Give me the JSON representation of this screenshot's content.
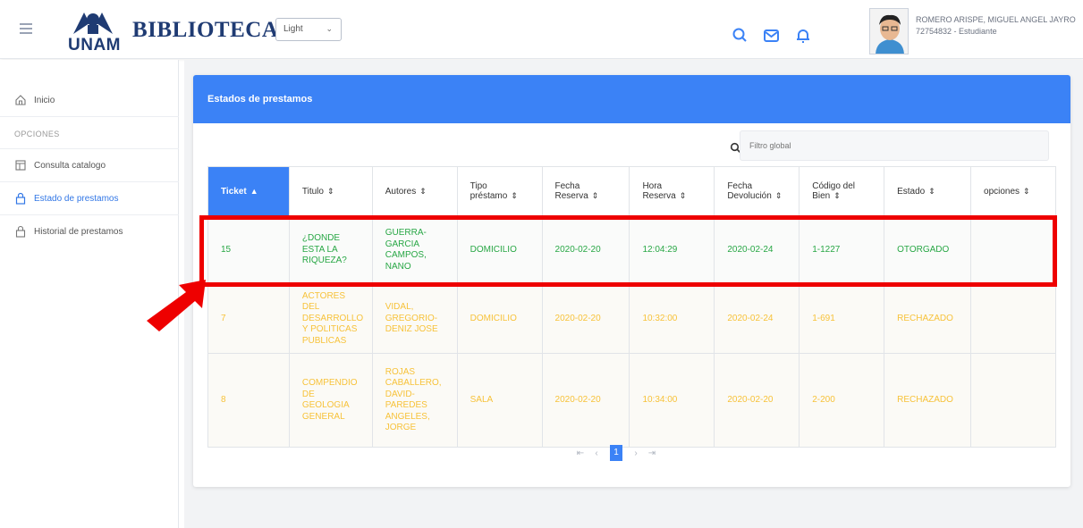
{
  "header": {
    "logo_text": "UNAM",
    "brand": "BIBLIOTECA",
    "theme_select": "Light",
    "user_name": "ROMERO ARISPE, MIGUEL ANGEL JAYRO",
    "user_role": "72754832 - Estudiante",
    "icons": [
      "menu-icon",
      "search-icon",
      "mail-icon",
      "bell-icon"
    ]
  },
  "sidebar": {
    "home": "Inicio",
    "section": "OPCIONES",
    "items": [
      {
        "label": "Consulta catalogo",
        "icon": "catalog-icon"
      },
      {
        "label": "Estado de prestamos",
        "icon": "lock-icon"
      },
      {
        "label": "Historial de prestamos",
        "icon": "lock-icon"
      }
    ]
  },
  "card": {
    "title": "Estados de prestamos",
    "filter_placeholder": "Filtro global"
  },
  "table": {
    "columns": [
      "Ticket",
      "Titulo",
      "Autores",
      "Tipo préstamo",
      "Fecha Reserva",
      "Hora Reserva",
      "Fecha Devolución",
      "Código del Bien",
      "Estado",
      "opciones"
    ],
    "rows": [
      {
        "ticket": "15",
        "titulo": "¿DONDE ESTA LA RIQUEZA?",
        "autores": "GUERRA-GARCIA CAMPOS, NANO",
        "tipo": "DOMICILIO",
        "fecha_reserva": "2020-02-20",
        "hora": "12:04:29",
        "fecha_dev": "2020-02-24",
        "codigo": "1-1227",
        "estado": "OTORGADO",
        "opciones": ""
      },
      {
        "ticket": "7",
        "titulo": "ACTORES DEL DESARROLLO Y POLITICAS PUBLICAS",
        "autores": "VIDAL, GREGORIO-DENIZ JOSE",
        "tipo": "DOMICILIO",
        "fecha_reserva": "2020-02-20",
        "hora": "10:32:00",
        "fecha_dev": "2020-02-24",
        "codigo": "1-691",
        "estado": "RECHAZADO",
        "opciones": ""
      },
      {
        "ticket": "8",
        "titulo": "COMPENDIO DE GEOLOGIA GENERAL",
        "autores": "ROJAS CABALLERO, DAVID-PAREDES ANGELES, JORGE",
        "tipo": "SALA",
        "fecha_reserva": "2020-02-20",
        "hora": "10:34:00",
        "fecha_dev": "2020-02-20",
        "codigo": "2-200",
        "estado": "RECHAZADO",
        "opciones": ""
      }
    ]
  },
  "pagination": {
    "current": "1"
  },
  "colors": {
    "accent": "#3b82f6",
    "ok": "#28a745",
    "rejected": "#f7c23a",
    "highlight": "#ee0000",
    "brand": "#1f3b73"
  }
}
